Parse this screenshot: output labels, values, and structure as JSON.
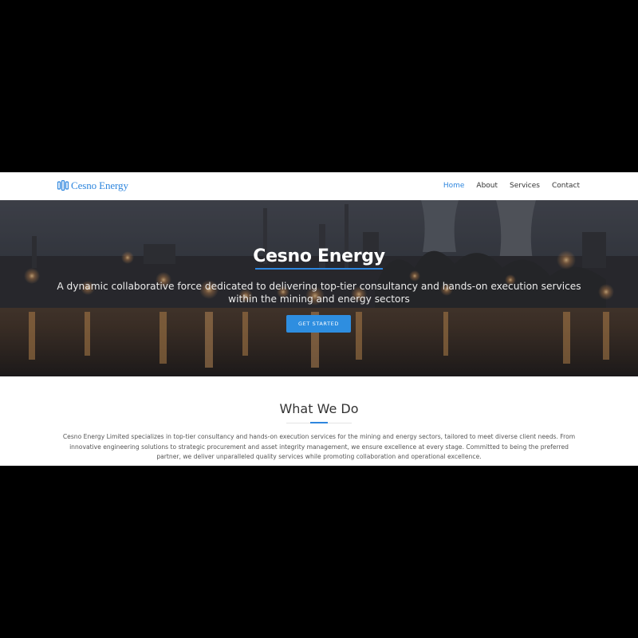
{
  "brand": {
    "name": "Cesno Energy",
    "logo_icon": "stacked-bars-logo-icon",
    "accent": "#2e86de"
  },
  "nav": {
    "items": [
      {
        "label": "Home",
        "active": true
      },
      {
        "label": "About",
        "active": false
      },
      {
        "label": "Services",
        "active": false
      },
      {
        "label": "Contact",
        "active": false
      }
    ]
  },
  "hero": {
    "title": "Cesno Energy",
    "subtitle": "A dynamic collaborative force dedicated to delivering top-tier consultancy and hands-on execution services within the mining and energy sectors",
    "cta_label": "GET STARTED",
    "cta_color": "#2e8ee0"
  },
  "what_we_do": {
    "title": "What We Do",
    "text": "Cesno Energy Limited specializes in top-tier consultancy and hands-on execution services for the mining and energy sectors, tailored to meet diverse client needs. From innovative engineering solutions to strategic procurement and asset integrity management, we ensure excellence at every stage. Committed to being the preferred partner, we deliver unparalleled quality services while promoting collaboration and operational excellence."
  }
}
